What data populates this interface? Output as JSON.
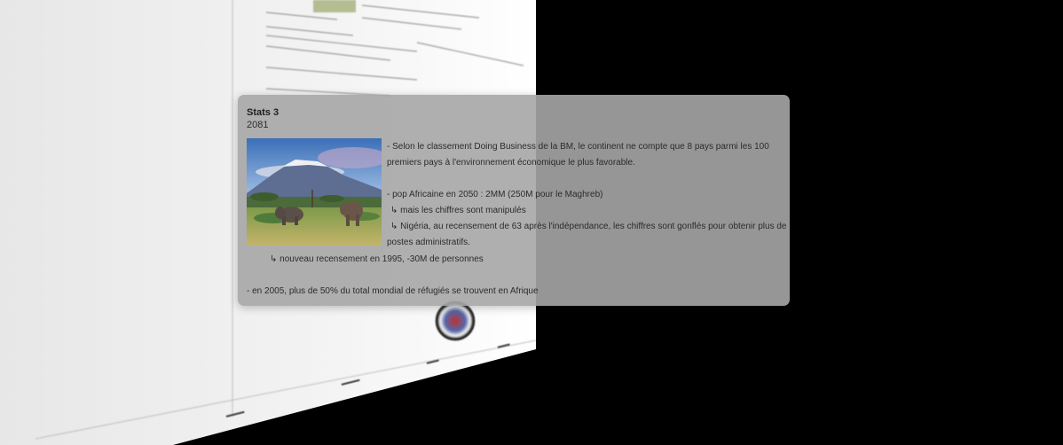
{
  "card": {
    "title": "Stats 3",
    "year": "2081",
    "photo_icon": "landscape-elephants-photo",
    "lines": [
      "- Selon le classement Doing Business de la BM, le continent ne compte que 8 pays parmi les 100",
      "premiers pays à l'environnement économique le plus favorable.",
      "- pop Africaine en 2050 : 2MM (250M pour le Maghreb)",
      "↳ mais les chiffres sont manipulés",
      "↳ Nigéria, au recensement de 63 après l'indépendance, les chiffres sont gonflés pour obtenir plus de",
      "postes administratifs.",
      "↳ nouveau recensement en 1995, -30M de personnes",
      "- en 2005, plus de 50% du total mondial de réfugiés se trouvent en Afrique"
    ]
  },
  "background_page": {
    "icon": "seal-emblem-icon"
  }
}
